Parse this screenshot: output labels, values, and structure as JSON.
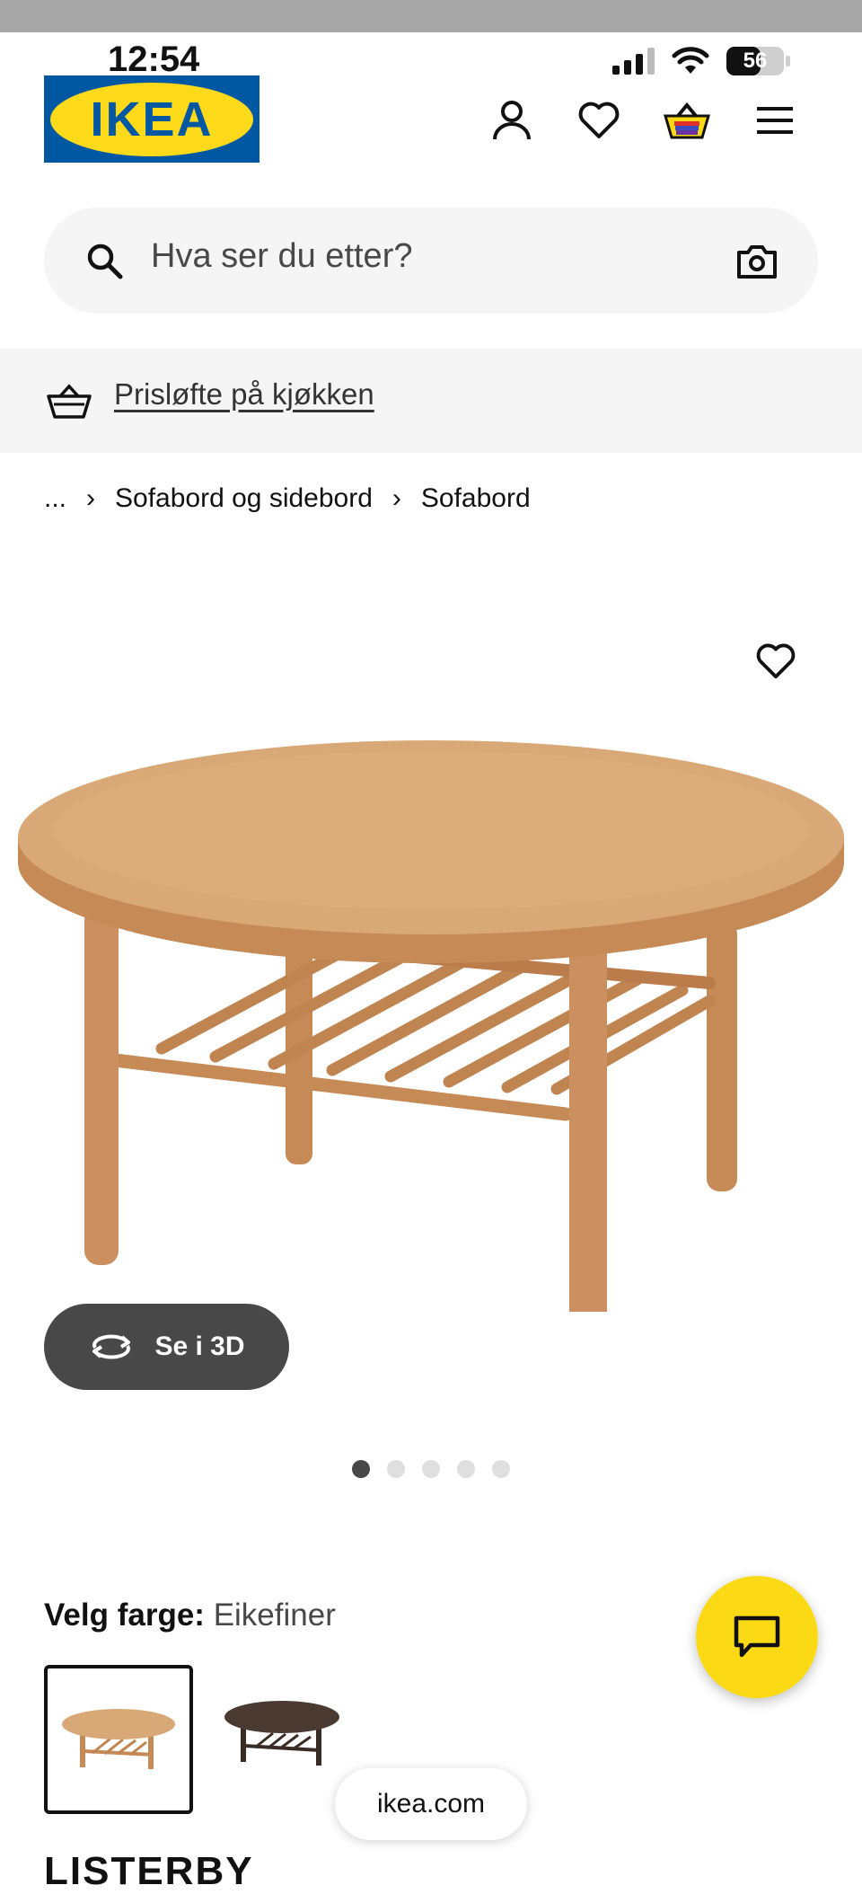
{
  "status_bar": {
    "time": "12:54",
    "battery": "56",
    "icons": [
      "signal-icon",
      "wifi-icon",
      "battery-icon"
    ]
  },
  "header": {
    "logo_text": "IKEA",
    "icons": [
      "profile-icon",
      "heart-icon",
      "basket-icon",
      "menu-icon"
    ]
  },
  "search": {
    "placeholder": "Hva ser du etter?",
    "icons": [
      "search-icon",
      "camera-icon"
    ]
  },
  "promo": {
    "link": "Prisløfte på kjøkken",
    "icon": "basket-outline-icon"
  },
  "breadcrumb": {
    "items": [
      "...",
      "Sofabord og sidebord",
      "Sofabord"
    ]
  },
  "product": {
    "image_icon": "round-coffee-table-image",
    "see_3d_label": "Se i 3D",
    "carousel": {
      "total": 5,
      "active": 1
    },
    "color_label": "Velg farge:",
    "color_value": "Eikefiner",
    "name_partial": "LISTERBY"
  },
  "browser": {
    "url": "ikea.com"
  },
  "colors": {
    "ikea_blue": "#0058a3",
    "ikea_yellow": "#ffda1a",
    "chat_yellow": "#fbd914",
    "dark_button": "#484848",
    "light_grey": "#f5f5f5"
  }
}
